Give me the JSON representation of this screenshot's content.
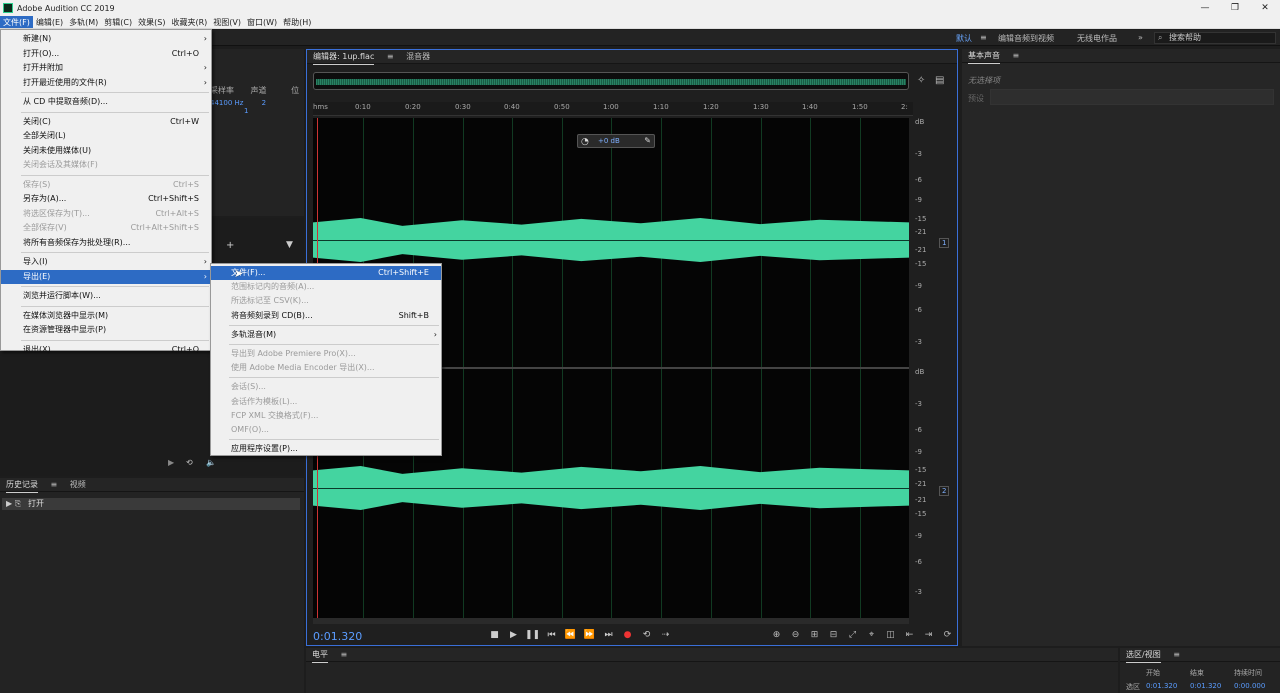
{
  "window": {
    "title": "Adobe Audition CC 2019"
  },
  "menubar": [
    {
      "label": "文件(F)",
      "active": true
    },
    {
      "label": "编辑(E)"
    },
    {
      "label": "多轨(M)"
    },
    {
      "label": "剪辑(C)"
    },
    {
      "label": "效果(S)"
    },
    {
      "label": "收藏夹(R)"
    },
    {
      "label": "视图(V)"
    },
    {
      "label": "窗口(W)"
    },
    {
      "label": "帮助(H)"
    }
  ],
  "workspaces": [
    "默认",
    "编辑音频到视频",
    "无线电作品"
  ],
  "help_search": "搜索帮助",
  "file_menu": [
    {
      "label": "新建(N)",
      "shortcut": "",
      "arrow": true
    },
    {
      "label": "打开(O)...",
      "shortcut": "Ctrl+O"
    },
    {
      "label": "打开并附加",
      "arrow": true
    },
    {
      "label": "打开最近使用的文件(R)",
      "arrow": true
    },
    {
      "sep": true
    },
    {
      "label": "从 CD 中提取音频(D)..."
    },
    {
      "sep": true
    },
    {
      "label": "关闭(C)",
      "shortcut": "Ctrl+W"
    },
    {
      "label": "全部关闭(L)"
    },
    {
      "label": "关闭未使用媒体(U)"
    },
    {
      "label": "关闭会话及其媒体(F)",
      "disabled": true
    },
    {
      "sep": true
    },
    {
      "label": "保存(S)",
      "shortcut": "Ctrl+S",
      "disabled": true
    },
    {
      "label": "另存为(A)...",
      "shortcut": "Ctrl+Shift+S"
    },
    {
      "label": "将选区保存为(T)...",
      "shortcut": "Ctrl+Alt+S",
      "disabled": true
    },
    {
      "label": "全部保存(V)",
      "shortcut": "Ctrl+Alt+Shift+S",
      "disabled": true
    },
    {
      "label": "将所有音频保存为批处理(R)..."
    },
    {
      "sep": true
    },
    {
      "label": "导入(I)",
      "arrow": true
    },
    {
      "label": "导出(E)",
      "arrow": true,
      "highlighted": true
    },
    {
      "sep": true
    },
    {
      "label": "浏览并运行脚本(W)..."
    },
    {
      "sep": true
    },
    {
      "label": "在媒体浏览器中显示(M)"
    },
    {
      "label": "在资源管理器中显示(P)"
    },
    {
      "sep": true
    },
    {
      "label": "退出(X)",
      "shortcut": "Ctrl+Q"
    }
  ],
  "export_submenu": [
    {
      "label": "文件(F)...",
      "shortcut": "Ctrl+Shift+E",
      "highlighted": true
    },
    {
      "label": "范围标记内的音频(A)...",
      "disabled": true
    },
    {
      "label": "所选标记至 CSV(K)...",
      "disabled": true
    },
    {
      "label": "将音频刻录到 CD(B)...",
      "shortcut": "Shift+B"
    },
    {
      "sep": true
    },
    {
      "label": "多轨混音(M)",
      "arrow": true
    },
    {
      "sep": true
    },
    {
      "label": "导出到 Adobe Premiere Pro(X)...",
      "disabled": true
    },
    {
      "label": "使用 Adobe Media Encoder 导出(X)...",
      "disabled": true
    },
    {
      "sep": true
    },
    {
      "label": "会话(S)...",
      "disabled": true
    },
    {
      "label": "会话作为模板(L)...",
      "disabled": true
    },
    {
      "label": "FCP XML 交换格式(F)...",
      "disabled": true
    },
    {
      "label": "OMF(O)...",
      "disabled": true
    },
    {
      "sep": true
    },
    {
      "label": "应用程序设置(P)..."
    }
  ],
  "files_panel": {
    "col_samplerate": "采样率",
    "col_channels": "声道",
    "col_more": "位",
    "samplerate": "44100 Hz",
    "channels": "2",
    "more": "1"
  },
  "editor": {
    "tab_editor": "编辑器: 1up.flac",
    "tab_mixer": "混音器",
    "ruler": [
      "hms",
      "0:10",
      "0:20",
      "0:30",
      "0:40",
      "0:50",
      "1:00",
      "1:10",
      "1:20",
      "1:30",
      "1:40",
      "1:50",
      "2:"
    ],
    "hud_value": "+0 dB",
    "db_top": [
      "dB",
      "-3",
      "-6",
      "-9",
      "-15",
      "-21",
      "-21",
      "-15",
      "-9",
      "-6",
      "-3"
    ],
    "db_bottom": [
      "dB",
      "-3",
      "-6",
      "-9",
      "-15",
      "-21",
      "-21",
      "-15",
      "-9",
      "-6",
      "-3"
    ],
    "channel_labels": [
      "1",
      "2"
    ],
    "timecode": "0:01.320"
  },
  "essential_sound": {
    "title": "基本声音",
    "no_selection": "无选择项",
    "preset_label": "预设"
  },
  "history": {
    "tab_history": "历史记录",
    "tab_video": "视频",
    "item": "打开"
  },
  "levels": {
    "title": "电平"
  },
  "selection_view": {
    "title": "选区/视图",
    "col_start": "开始",
    "col_end": "结束",
    "col_duration": "持续时间",
    "row_label": "选区",
    "start": "0:01.320",
    "end": "0:01.320",
    "duration": "0:00.000"
  }
}
